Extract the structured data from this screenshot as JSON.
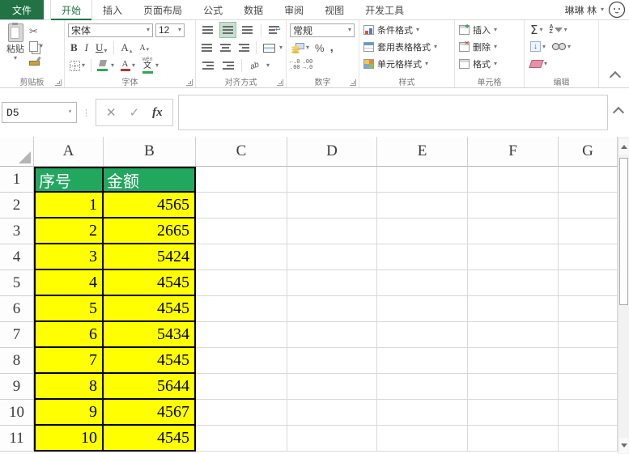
{
  "account": {
    "user_name": "琳琳 林"
  },
  "tabs": {
    "file": "文件",
    "items": [
      {
        "label": "开始",
        "selected": true
      },
      {
        "label": "插入"
      },
      {
        "label": "页面布局"
      },
      {
        "label": "公式"
      },
      {
        "label": "数据"
      },
      {
        "label": "审阅"
      },
      {
        "label": "视图"
      },
      {
        "label": "开发工具"
      }
    ]
  },
  "ribbon": {
    "clipboard": {
      "group_label": "剪贴板",
      "paste_label": "粘贴"
    },
    "font": {
      "group_label": "字体",
      "font_name": "宋体",
      "font_size": "12",
      "bold": "B",
      "italic": "I",
      "underline": "U",
      "grow": "A",
      "shrink": "A",
      "color": "A",
      "phonetic_char": "文",
      "phonetic_pinyin": "wén"
    },
    "alignment": {
      "group_label": "对齐方式",
      "orientation": "ab"
    },
    "number": {
      "group_label": "数字",
      "format": "常规",
      "percent": "%",
      "comma": ",",
      "inc_top": "←.0",
      "inc_bottom": ".00",
      "dec_top": ".00",
      "dec_bottom": "→.0"
    },
    "styles": {
      "group_label": "样式",
      "conditional_formatting": "条件格式",
      "format_as_table": "套用表格格式",
      "cell_styles": "单元格样式"
    },
    "cells": {
      "group_label": "单元格",
      "insert": "插入",
      "delete": "删除",
      "format": "格式"
    },
    "editing": {
      "group_label": "编辑",
      "autosum": "Σ"
    }
  },
  "formula_bar": {
    "name_box": "D5",
    "fx_label": "fx",
    "formula": ""
  },
  "grid": {
    "column_headers": [
      "A",
      "B",
      "C",
      "D",
      "E",
      "F",
      "G"
    ],
    "row_numbers": [
      "1",
      "2",
      "3",
      "4",
      "5",
      "6",
      "7",
      "8",
      "9",
      "10",
      "11"
    ],
    "table": {
      "headers": [
        "序号",
        "金额"
      ],
      "rows": [
        [
          "1",
          "4565"
        ],
        [
          "2",
          "2665"
        ],
        [
          "3",
          "5424"
        ],
        [
          "4",
          "4545"
        ],
        [
          "5",
          "4545"
        ],
        [
          "6",
          "5434"
        ],
        [
          "7",
          "4545"
        ],
        [
          "8",
          "5644"
        ],
        [
          "9",
          "4567"
        ],
        [
          "10",
          "4545"
        ]
      ]
    },
    "colors": {
      "excel_green": "#217346",
      "header_fill": "#22a75f",
      "header_text": "#ffffff",
      "data_fill": "#ffff00",
      "selected_align_bg": "#c7e0cf"
    }
  }
}
